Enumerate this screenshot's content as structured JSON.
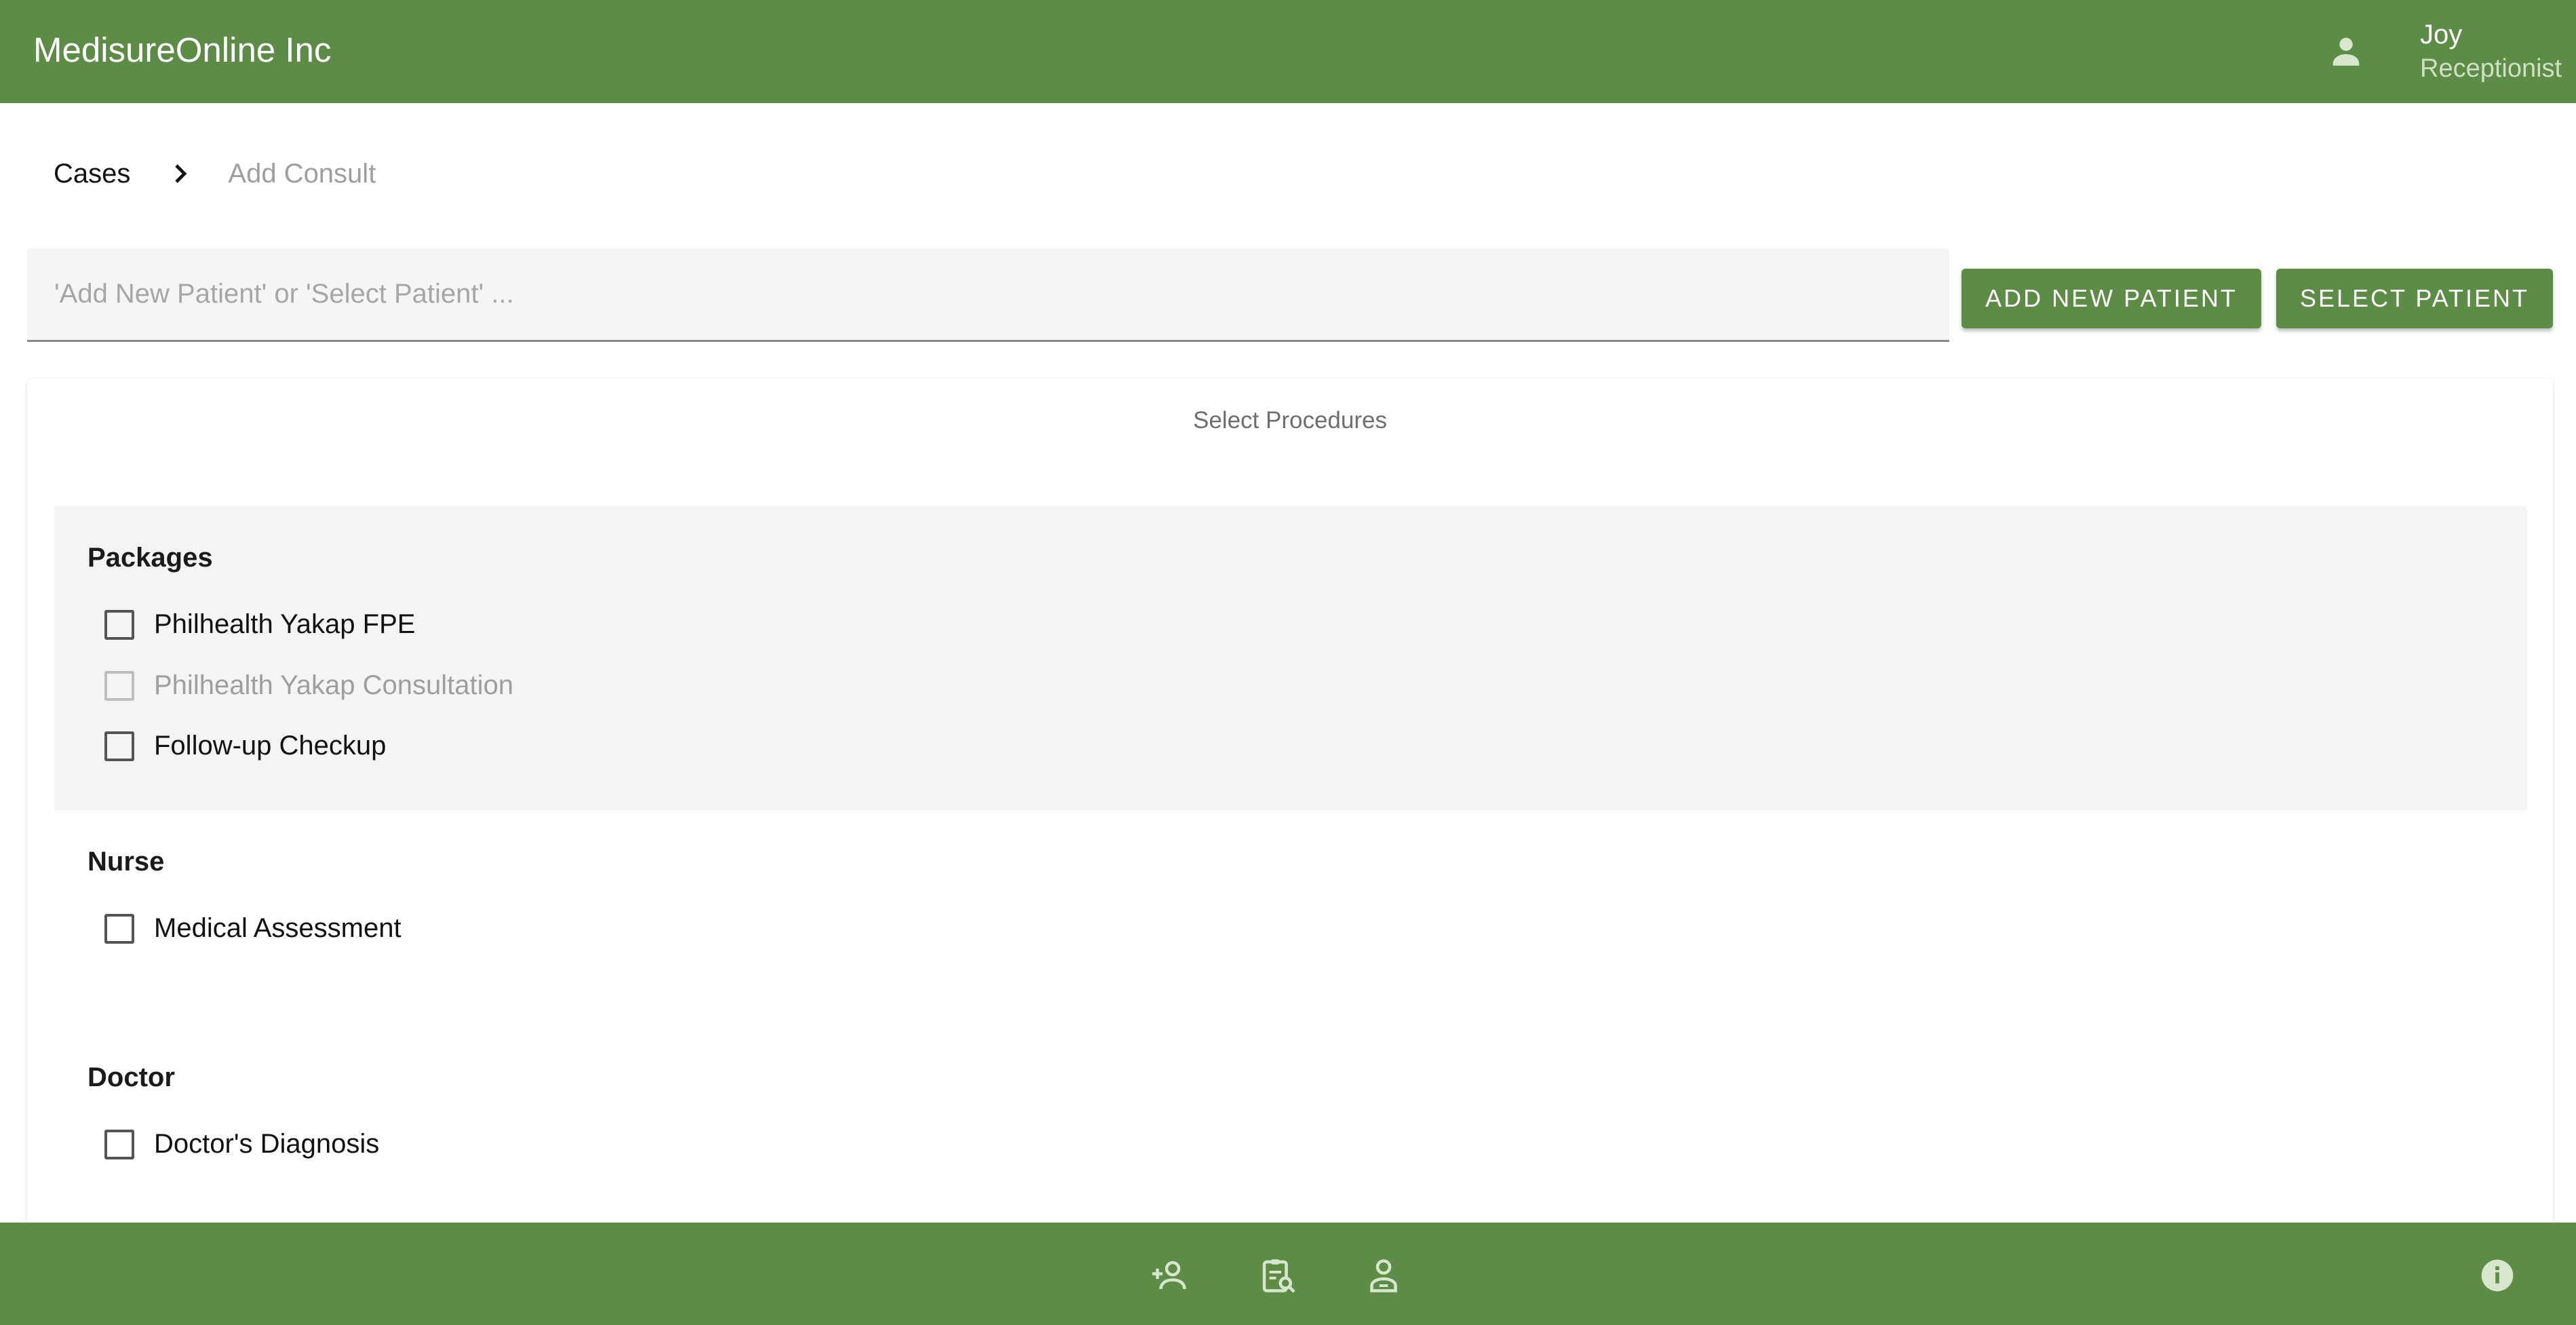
{
  "app": {
    "brand": "MedisureOnline Inc",
    "brand_color": "#5c8c45"
  },
  "user": {
    "icon": "account-icon",
    "name": "Joy",
    "role": "Receptionist"
  },
  "breadcrumb": {
    "items": [
      "Cases",
      "Add Consult"
    ],
    "separator_icon": "chevron-right-icon"
  },
  "patient": {
    "placeholder": "'Add New Patient' or 'Select Patient' ...",
    "value": "",
    "add_button": "ADD NEW PATIENT",
    "select_button": "SELECT PATIENT"
  },
  "procedures": {
    "title": "Select Procedures",
    "groups": [
      {
        "heading": "Packages",
        "options": [
          {
            "label": "Philhealth Yakap FPE",
            "checked": false,
            "disabled": false
          },
          {
            "label": "Philhealth Yakap Consultation",
            "checked": false,
            "disabled": true
          },
          {
            "label": "Follow-up Checkup",
            "checked": false,
            "disabled": false
          }
        ]
      },
      {
        "heading": "Nurse",
        "options": [
          {
            "label": "Medical Assessment",
            "checked": false,
            "disabled": false
          }
        ]
      },
      {
        "heading": "Doctor",
        "options": [
          {
            "label": "Doctor's Diagnosis",
            "checked": false,
            "disabled": false
          }
        ]
      }
    ]
  },
  "bottom_nav": {
    "icons": [
      "person-add-icon",
      "clipboard-search-icon",
      "person-badge-icon",
      "info-icon"
    ]
  }
}
